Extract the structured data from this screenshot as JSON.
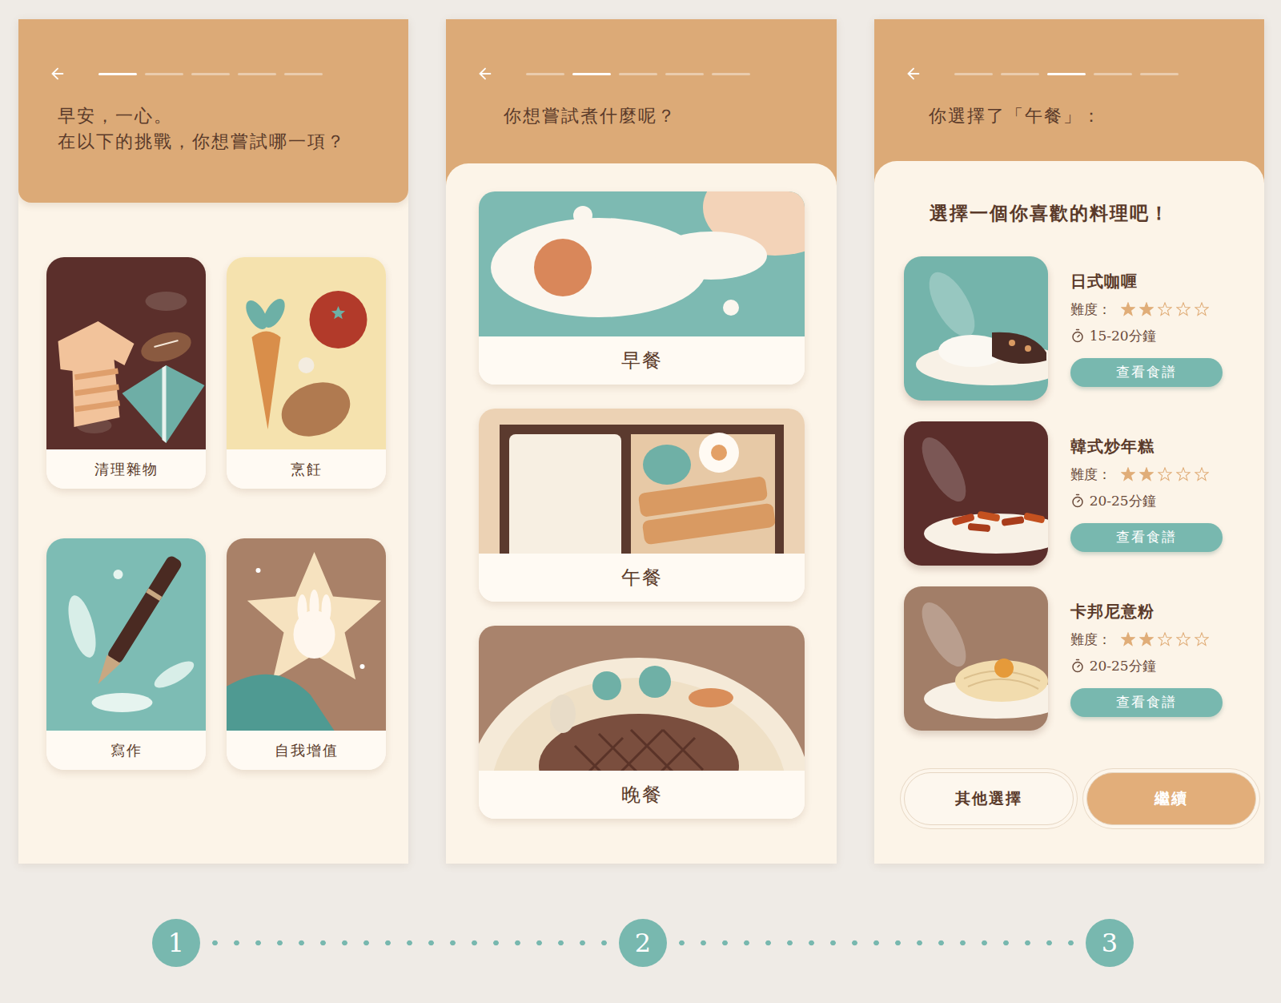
{
  "screens": [
    {
      "progress": [
        {
          "selected": true
        },
        {
          "selected": false
        },
        {
          "selected": false
        },
        {
          "selected": false
        },
        {
          "selected": false
        }
      ],
      "title": [
        "早安，一心。",
        "在以下的挑戰，你想嘗試哪一項？"
      ],
      "challenges": [
        {
          "label": "清理雜物",
          "color": "#5b2f2b"
        },
        {
          "label": "烹飪",
          "color": "#f5e2ae"
        },
        {
          "label": "寫作",
          "color": "#7dbcb4"
        },
        {
          "label": "自我增值",
          "color": "#a98168"
        }
      ]
    },
    {
      "progress": [
        {
          "selected": false
        },
        {
          "selected": true
        },
        {
          "selected": false
        },
        {
          "selected": false
        },
        {
          "selected": false
        }
      ],
      "title": [
        "你想嘗試煮什麼呢？"
      ],
      "meals": [
        {
          "label": "早餐",
          "color": "#7dbab2"
        },
        {
          "label": "午餐",
          "color": "#ecd2b4"
        },
        {
          "label": "晚餐",
          "color": "#a9836c"
        }
      ]
    },
    {
      "progress": [
        {
          "selected": false
        },
        {
          "selected": false
        },
        {
          "selected": true
        },
        {
          "selected": false
        },
        {
          "selected": false
        }
      ],
      "title": [
        "你選擇了「午餐」："
      ],
      "subtitle": "選擇一個你喜歡的料理吧！",
      "recipes": [
        {
          "name": "日式咖喱",
          "difficulty_label": "難度：",
          "stars": 2,
          "max_stars": 5,
          "time": "15-20分鐘",
          "button": "查看食譜",
          "color": "#74b4ab"
        },
        {
          "name": "韓式炒年糕",
          "difficulty_label": "難度：",
          "stars": 2,
          "max_stars": 5,
          "time": "20-25分鐘",
          "button": "查看食譜",
          "color": "#5b2e2b"
        },
        {
          "name": "卡邦尼意粉",
          "difficulty_label": "難度：",
          "stars": 2,
          "max_stars": 5,
          "time": "20-25分鐘",
          "button": "查看食譜",
          "color": "#a27e68"
        }
      ],
      "buttons": [
        {
          "label": "其他選擇",
          "kind": "secondary"
        },
        {
          "label": "繼續",
          "kind": "primary"
        }
      ]
    }
  ],
  "steps": [
    "1",
    "2",
    "3"
  ]
}
